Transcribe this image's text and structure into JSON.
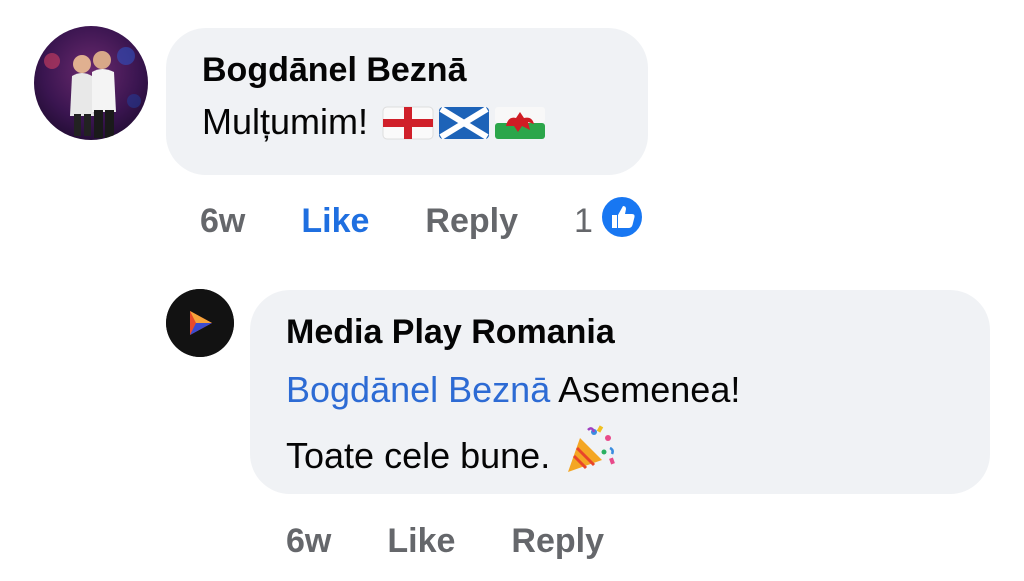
{
  "comments": [
    {
      "author": "Bogdānel Beznā",
      "text": "Mulțumim!",
      "flags": [
        "england-flag",
        "scotland-flag",
        "wales-flag"
      ],
      "time": "6w",
      "like_label": "Like",
      "reply_label": "Reply",
      "reaction_count": "1",
      "reaction_icon": "like-reaction-icon",
      "like_color": "#1f6fe0"
    },
    {
      "author": "Media Play Romania",
      "mention": "Bogdānel Beznā",
      "text_line1": "Asemenea!",
      "text_line2": "Toate cele bune.",
      "emoji": "party-popper-icon",
      "time": "6w",
      "like_label": "Like",
      "reply_label": "Reply"
    }
  ],
  "colors": {
    "bubble_bg": "#f0f2f5",
    "mention": "#2d6bd4",
    "meta_text": "#65676b"
  }
}
